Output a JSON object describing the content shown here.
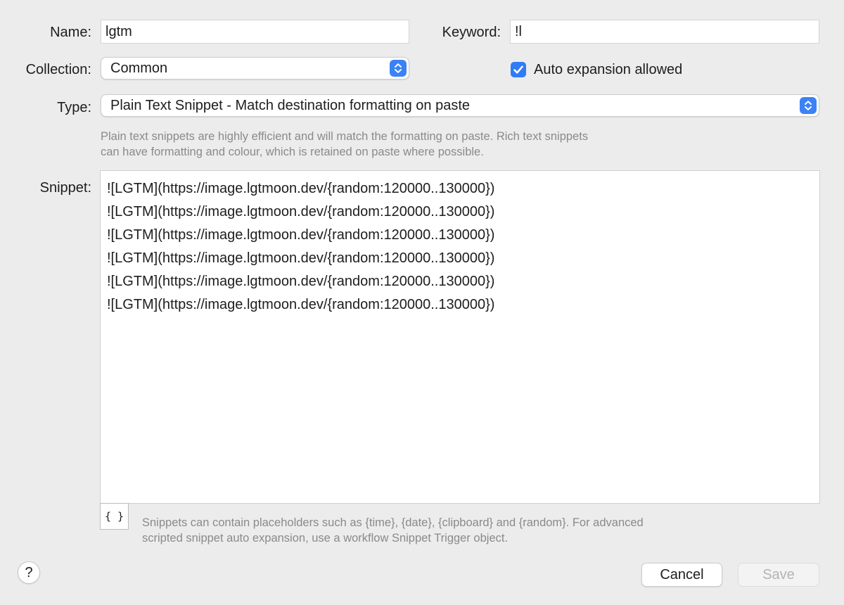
{
  "form": {
    "name_label": "Name:",
    "name_value": "lgtm",
    "keyword_label": "Keyword:",
    "keyword_value": "!l",
    "collection_label": "Collection:",
    "collection_value": "Common",
    "auto_expansion_label": "Auto expansion allowed",
    "auto_expansion_checked": true,
    "type_label": "Type:",
    "type_value": "Plain Text Snippet - Match destination formatting on paste",
    "type_help": [
      "Plain text snippets are highly efficient and will match the formatting on paste. Rich text snippets",
      "can have formatting and colour, which is retained on paste where possible."
    ],
    "snippet_label": "Snippet:",
    "snippet_lines": [
      "![LGTM](https://image.lgtmoon.dev/{random:120000..130000})",
      "![LGTM](https://image.lgtmoon.dev/{random:120000..130000})",
      "![LGTM](https://image.lgtmoon.dev/{random:120000..130000})",
      "![LGTM](https://image.lgtmoon.dev/{random:120000..130000})",
      "![LGTM](https://image.lgtmoon.dev/{random:120000..130000})",
      "![LGTM](https://image.lgtmoon.dev/{random:120000..130000})"
    ],
    "placeholder_button_label": "{ }",
    "placeholder_help": [
      "Snippets can contain placeholders such as {time}, {date}, {clipboard} and {random}. For advanced",
      "scripted snippet auto expansion, use a workflow Snippet Trigger object."
    ]
  },
  "footer": {
    "help_label": "?",
    "cancel_label": "Cancel",
    "save_label": "Save"
  },
  "colors": {
    "accent": "#3b82f6",
    "background": "#ececec"
  },
  "icons": {
    "stepper": "chevron-up-down-icon",
    "checkbox": "checkmark-icon"
  }
}
